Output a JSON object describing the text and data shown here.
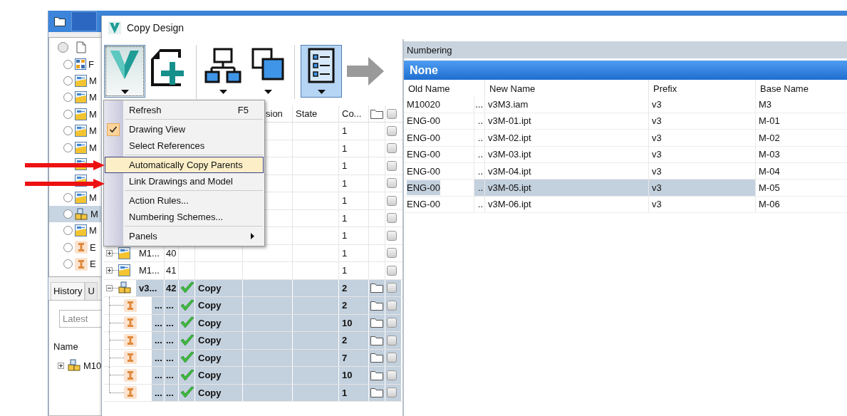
{
  "background_window": {
    "tree_rows": [
      {
        "kind": "document",
        "radio": true,
        "selected": false
      },
      {
        "kind": "grid",
        "name": "F",
        "radio": true,
        "selected": false
      },
      {
        "kind": "drawing",
        "name": "M",
        "radio": true,
        "selected": false
      },
      {
        "kind": "drawing",
        "name": "M",
        "radio": true,
        "selected": false
      },
      {
        "kind": "drawing",
        "name": "M",
        "radio": true,
        "selected": false
      },
      {
        "kind": "drawing",
        "name": "M",
        "radio": true,
        "selected": false
      },
      {
        "kind": "drawing",
        "name": "M",
        "radio": true,
        "selected": false
      },
      {
        "kind": "drawing",
        "radio": false,
        "selected": false
      },
      {
        "kind": "drawing",
        "radio": false,
        "selected": false
      },
      {
        "kind": "drawing",
        "name": "M",
        "radio": true,
        "selected": false
      },
      {
        "kind": "assembly",
        "name": "M",
        "radio": true,
        "selected": true
      },
      {
        "kind": "drawing",
        "name": "M",
        "radio": true,
        "selected": false
      },
      {
        "kind": "part",
        "name": "E",
        "radio": true,
        "selected": false
      },
      {
        "kind": "part",
        "name": "E",
        "radio": true,
        "selected": false
      }
    ],
    "tabs": [
      {
        "label": "History",
        "selected": true
      },
      {
        "label": "U",
        "selected": false
      }
    ],
    "version_field": {
      "value": "Latest"
    },
    "list_header": "Name",
    "list_rows": [
      {
        "kind": "assembly",
        "name": "M10",
        "expanded": false
      }
    ]
  },
  "dialog": {
    "title": "Copy Design",
    "toolbar": [
      {
        "kind": "logo",
        "dropdown": true,
        "pressed": false,
        "menu_open": true,
        "disabled": false
      },
      {
        "kind": "new-file",
        "dropdown": false,
        "pressed": false,
        "menu_open": false,
        "disabled": false
      },
      {
        "kind": "separator"
      },
      {
        "kind": "hierarchy",
        "dropdown": true,
        "pressed": false,
        "menu_open": false,
        "disabled": false
      },
      {
        "kind": "copy",
        "dropdown": true,
        "pressed": false,
        "menu_open": false,
        "disabled": false
      },
      {
        "kind": "separator"
      },
      {
        "kind": "list",
        "dropdown": true,
        "pressed": true,
        "menu_open": false,
        "disabled": false
      },
      {
        "kind": "arrow",
        "dropdown": false,
        "pressed": false,
        "menu_open": false,
        "disabled": true
      }
    ],
    "grid": {
      "header": {
        "column_5": "sion",
        "state": "State",
        "count": "Co...",
        "checked": false
      },
      "rows": [
        {
          "count": "1",
          "folder": false,
          "checked": false,
          "selected": false
        },
        {
          "count": "1",
          "folder": false,
          "checked": false,
          "selected": false
        },
        {
          "count": "1",
          "folder": false,
          "checked": false,
          "selected": false
        },
        {
          "count": "1",
          "folder": false,
          "checked": false,
          "selected": false
        },
        {
          "count": "1",
          "folder": false,
          "checked": false,
          "selected": false
        },
        {
          "count": "1",
          "folder": false,
          "checked": false,
          "selected": false
        },
        {
          "count": "1",
          "folder": false,
          "checked": false,
          "selected": false
        },
        {
          "expanded": false,
          "kind": "drawing",
          "name": "M1...",
          "number": "40",
          "count": "1",
          "folder": false,
          "checked": false,
          "selected": false
        },
        {
          "expanded": false,
          "kind": "drawing",
          "name": "M1...",
          "number": "41",
          "count": "1",
          "folder": false,
          "checked": false,
          "selected": false
        },
        {
          "expanded": true,
          "kind": "assembly",
          "name": "v3...",
          "number": "42",
          "action": "Copy",
          "count": "2",
          "folder": true,
          "checked": false,
          "selected": true,
          "children": [
            {
              "kind": "part",
              "name": "...",
              "number": "...",
              "action": "Copy",
              "count": "2",
              "folder": true,
              "checked": false,
              "selected": true
            },
            {
              "kind": "part",
              "name": "...",
              "number": "...",
              "action": "Copy",
              "count": "10",
              "folder": true,
              "checked": false,
              "selected": true
            },
            {
              "kind": "part",
              "name": "...",
              "number": "...",
              "action": "Copy",
              "count": "2",
              "folder": true,
              "checked": false,
              "selected": true
            },
            {
              "kind": "part",
              "name": "...",
              "number": "...",
              "action": "Copy",
              "count": "7",
              "folder": true,
              "checked": false,
              "selected": true
            },
            {
              "kind": "part",
              "name": "...",
              "number": "...",
              "action": "Copy",
              "count": "10",
              "folder": true,
              "checked": false,
              "selected": true
            },
            {
              "kind": "part",
              "name": "...",
              "number": "...",
              "action": "Copy",
              "count": "1",
              "folder": true,
              "checked": false,
              "selected": true
            }
          ]
        }
      ]
    },
    "menu": {
      "groups": [
        {
          "items": [
            {
              "kind": "command",
              "label": "Refresh",
              "shortcut": "F5",
              "checked": false,
              "highlighted": false
            }
          ]
        },
        {
          "items": [
            {
              "kind": "command",
              "label": "Drawing View",
              "checked": true,
              "highlighted": false
            },
            {
              "kind": "command",
              "label": "Select References",
              "checked": false,
              "highlighted": false
            }
          ]
        },
        {
          "items": [
            {
              "kind": "command",
              "label": "Automatically Copy Parents",
              "checked": false,
              "highlighted": true
            },
            {
              "kind": "command",
              "label": "Link Drawings and Model",
              "checked": false,
              "highlighted": false
            }
          ]
        },
        {
          "items": [
            {
              "kind": "command",
              "label": "Action Rules...",
              "checked": false,
              "highlighted": false
            },
            {
              "kind": "command",
              "label": "Numbering Schemes...",
              "checked": false,
              "highlighted": false
            }
          ]
        },
        {
          "items": [
            {
              "kind": "submenu",
              "label": "Panels",
              "checked": false,
              "highlighted": false
            }
          ]
        }
      ]
    },
    "numbering": {
      "title": "Numbering",
      "scheme": "None",
      "columns": [
        "Old Name",
        "New Name",
        "Prefix",
        "Base Name"
      ],
      "rows": [
        {
          "old_name": "M10020",
          "column_2": "...",
          "new_name": "v3M3.iam",
          "prefix": "v3",
          "base_name": "M3",
          "selected": false
        },
        {
          "old_name": "ENG-00",
          "column_2": "..",
          "new_name": "v3M-01.ipt",
          "prefix": "v3",
          "base_name": "M-01",
          "selected": false
        },
        {
          "old_name": "ENG-00",
          "column_2": "..",
          "new_name": "v3M-02.ipt",
          "prefix": "v3",
          "base_name": "M-02",
          "selected": false
        },
        {
          "old_name": "ENG-00",
          "column_2": "..",
          "new_name": "v3M-03.ipt",
          "prefix": "v3",
          "base_name": "M-03",
          "selected": false
        },
        {
          "old_name": "ENG-00",
          "column_2": "..",
          "new_name": "v3M-04.ipt",
          "prefix": "v3",
          "base_name": "M-04",
          "selected": false
        },
        {
          "old_name": "ENG-00",
          "column_2": "..",
          "new_name": "v3M-05.ipt",
          "prefix": "v3",
          "base_name": "M-05",
          "selected": true
        },
        {
          "old_name": "ENG-00",
          "column_2": "..",
          "new_name": "v3M-06.ipt",
          "prefix": "v3",
          "base_name": "M-06",
          "selected": false
        }
      ]
    }
  },
  "callout_arrows": [
    {
      "kind": "arrow"
    },
    {
      "kind": "arrow"
    }
  ]
}
